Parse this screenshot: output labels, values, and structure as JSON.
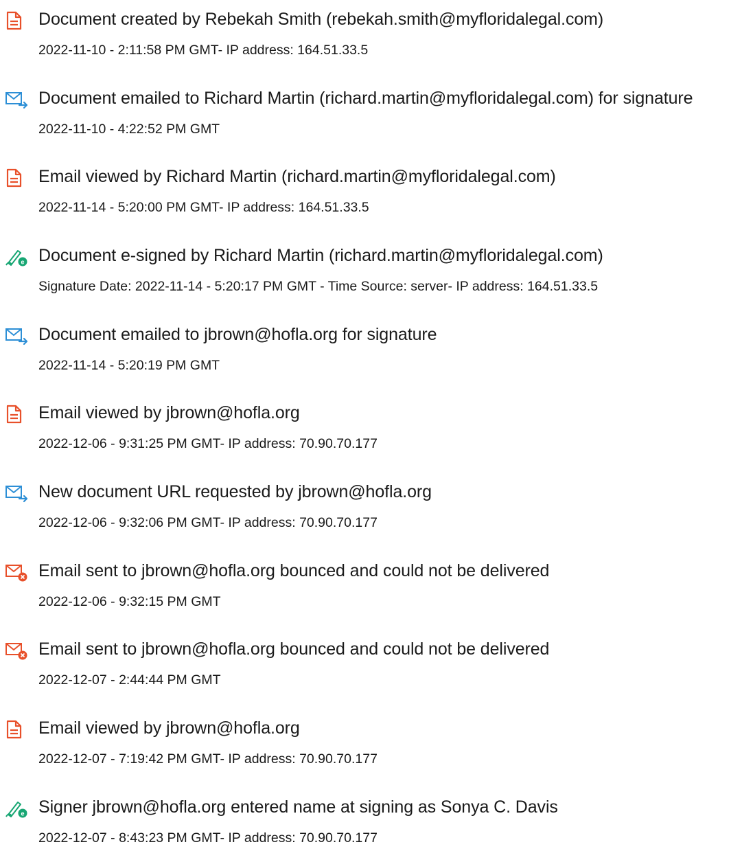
{
  "colors": {
    "doc_icon": "#e8502a",
    "mail_icon": "#2d8fd6",
    "sign_icon": "#17a673",
    "bounce_icon": "#e8502a",
    "text": "#1a1a1a"
  },
  "events": [
    {
      "icon": "document-icon",
      "title": "Document created by Rebekah Smith (rebekah.smith@myfloridalegal.com)",
      "detail": "2022-11-10 - 2:11:58 PM GMT- IP address: 164.51.33.5"
    },
    {
      "icon": "email-send-icon",
      "title": "Document emailed to Richard Martin (richard.martin@myfloridalegal.com) for signature",
      "detail": "2022-11-10 - 4:22:52 PM GMT"
    },
    {
      "icon": "document-icon",
      "title": "Email viewed by Richard Martin (richard.martin@myfloridalegal.com)",
      "detail": "2022-11-14 - 5:20:00 PM GMT- IP address: 164.51.33.5"
    },
    {
      "icon": "esign-icon",
      "title": "Document e-signed by Richard Martin (richard.martin@myfloridalegal.com)",
      "detail": "Signature Date: 2022-11-14 - 5:20:17 PM GMT - Time Source: server- IP address: 164.51.33.5"
    },
    {
      "icon": "email-send-icon",
      "title": "Document emailed to jbrown@hofla.org for signature",
      "detail": "2022-11-14 - 5:20:19 PM GMT"
    },
    {
      "icon": "document-icon",
      "title": "Email viewed by jbrown@hofla.org",
      "detail": "2022-12-06 - 9:31:25 PM GMT- IP address: 70.90.70.177"
    },
    {
      "icon": "email-send-icon",
      "title": "New document URL requested by jbrown@hofla.org",
      "detail": "2022-12-06 - 9:32:06 PM GMT- IP address: 70.90.70.177"
    },
    {
      "icon": "email-bounce-icon",
      "title": "Email sent to jbrown@hofla.org bounced and could not be delivered",
      "detail": "2022-12-06 - 9:32:15 PM GMT"
    },
    {
      "icon": "email-bounce-icon",
      "title": "Email sent to jbrown@hofla.org bounced and could not be delivered",
      "detail": "2022-12-07 - 2:44:44 PM GMT"
    },
    {
      "icon": "document-icon",
      "title": "Email viewed by jbrown@hofla.org",
      "detail": "2022-12-07 - 7:19:42 PM GMT- IP address: 70.90.70.177"
    },
    {
      "icon": "esign-icon",
      "title": "Signer jbrown@hofla.org entered name at signing as Sonya C. Davis",
      "detail": "2022-12-07 - 8:43:23 PM GMT- IP address: 70.90.70.177"
    }
  ]
}
